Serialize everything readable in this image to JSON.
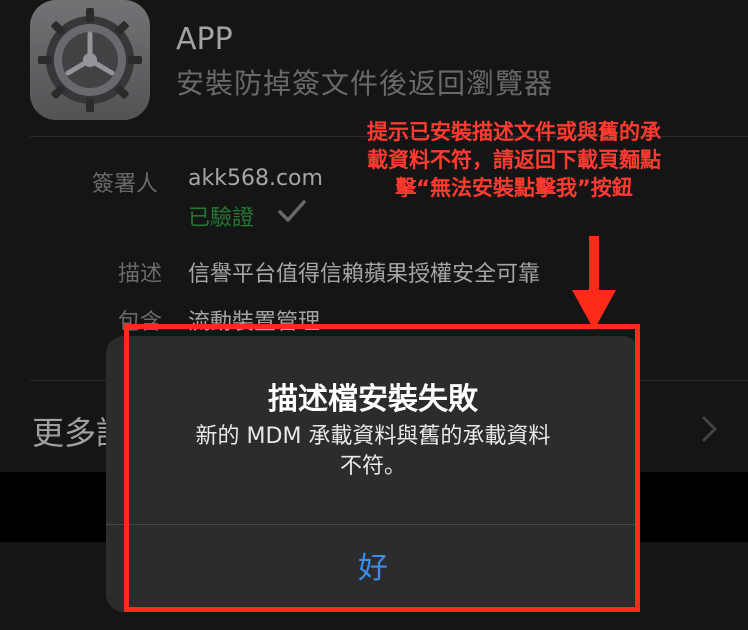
{
  "app": {
    "title": "APP",
    "subtitle": "安裝防掉簽文件後返回瀏覽器"
  },
  "details": {
    "signer_label": "簽署人",
    "signer_value": "akk568.com",
    "verified_text": "已驗證",
    "description_label": "描述",
    "description_value": "信譽平台值得信賴蘋果授權安全可靠",
    "contains_label": "包含",
    "contains_value": "流動裝置管理",
    "more_label": "更多詳"
  },
  "annotation": {
    "line1": "提示已安裝描述文件或與舊的承",
    "line2": "載資料不符，請返回下載頁麵點",
    "line3": "擊“無法安裝點擊我”按鈕"
  },
  "alert": {
    "title": "描述檔安裝失敗",
    "message_line1": "新的 MDM 承載資料與舊的承載資料",
    "message_line2": "不符。",
    "ok_label": "好"
  },
  "colors": {
    "background": "#1c1c1e",
    "dialog": "#2c2c2e",
    "accent": "#3b8de8",
    "verified": "#2ea043",
    "annotation": "#ff3b30",
    "highlight": "#ff2a1a"
  },
  "icons": [
    "settings-gear-icon",
    "checkmark-icon",
    "chevron-right-icon",
    "down-arrow-icon"
  ]
}
